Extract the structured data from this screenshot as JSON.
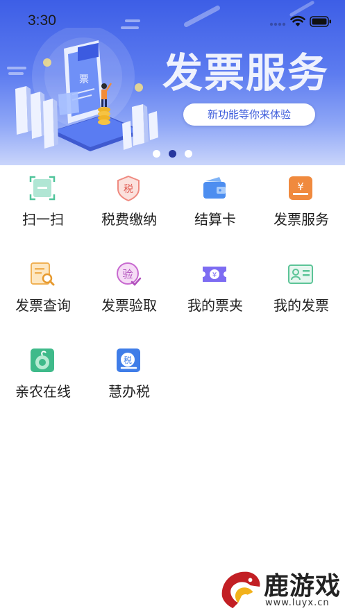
{
  "status_bar": {
    "time": "3:30"
  },
  "banner": {
    "headline": "发票服务",
    "promo_button": "新功能等你来体验",
    "illustration_sign": "票",
    "dots": [
      {
        "active": false
      },
      {
        "active": true
      },
      {
        "active": false
      }
    ]
  },
  "services": [
    {
      "label": "扫一扫",
      "icon": "scan-icon"
    },
    {
      "label": "税费缴纳",
      "icon": "tax-shield-icon"
    },
    {
      "label": "结算卡",
      "icon": "wallet-icon"
    },
    {
      "label": "发票服务",
      "icon": "invoice-yen-icon"
    },
    {
      "label": "发票查询",
      "icon": "invoice-search-icon"
    },
    {
      "label": "发票验取",
      "icon": "verify-icon"
    },
    {
      "label": "我的票夹",
      "icon": "ticket-icon"
    },
    {
      "label": "我的发票",
      "icon": "id-card-icon"
    },
    {
      "label": "亲农在线",
      "icon": "agriculture-icon"
    },
    {
      "label": "慧办税",
      "icon": "smart-tax-icon"
    }
  ],
  "icon_glyphs": {
    "tax": "税",
    "verify": "验",
    "yen": "¥"
  },
  "watermark": {
    "title": "鹿游戏",
    "url": "www.luyx.cn"
  }
}
